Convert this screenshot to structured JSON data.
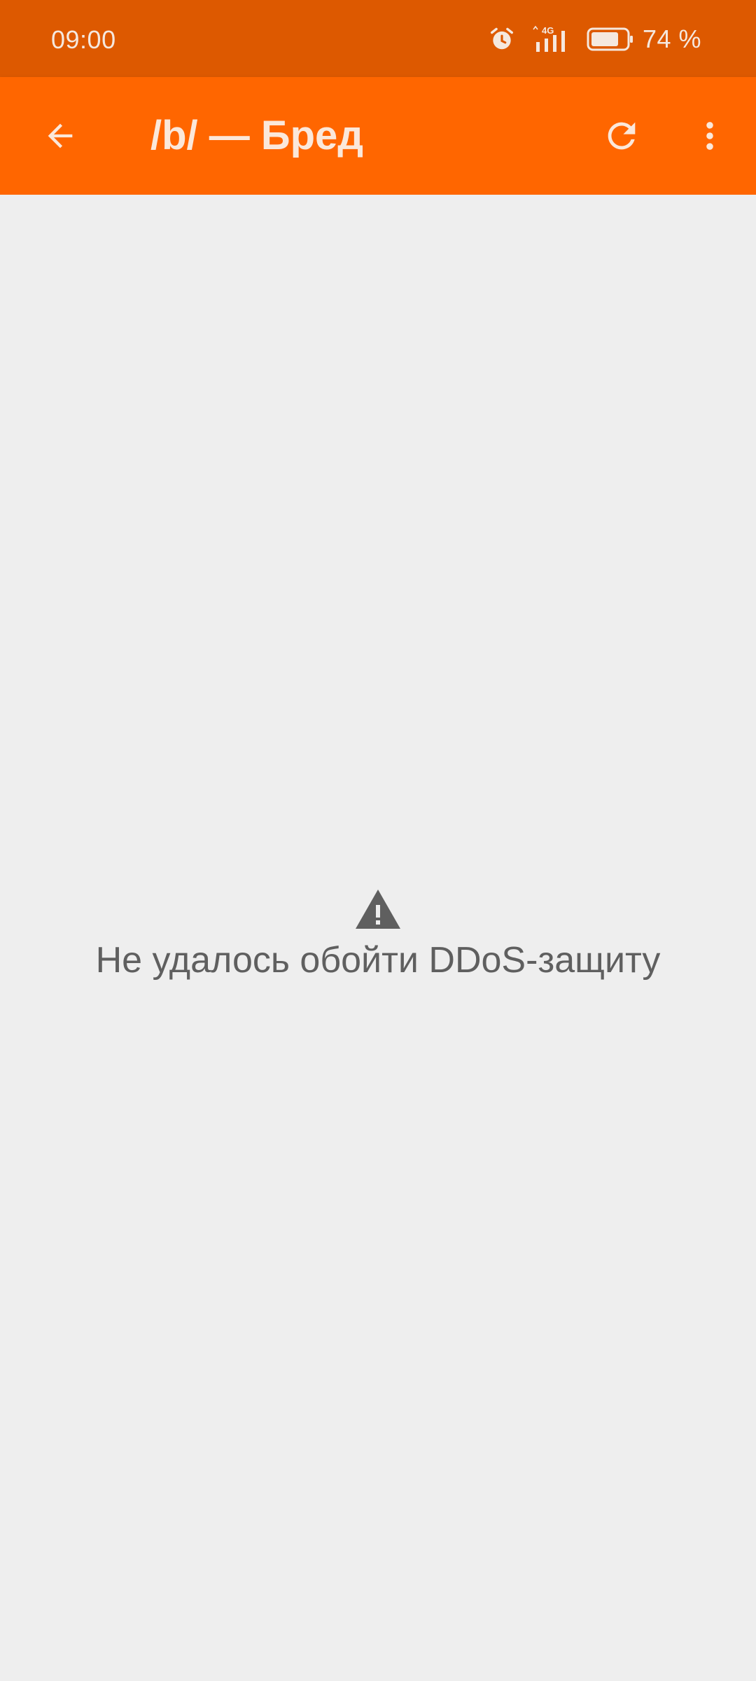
{
  "status_bar": {
    "time": "09:00",
    "network": "4G",
    "battery": "74 %",
    "icons": [
      "alarm-icon",
      "signal-icon",
      "battery-icon"
    ]
  },
  "app_bar": {
    "title": "/b/ — Бред",
    "icons": [
      "back-arrow-icon",
      "refresh-icon",
      "more-vert-icon"
    ],
    "color": "#ff6600"
  },
  "content": {
    "error_message": "Не удалось обойти DDoS-защиту",
    "error_icon": "warning-icon"
  },
  "colors": {
    "status_bar": "#dd5900",
    "app_bar": "#ff6600",
    "background": "#eeeeee",
    "error_text": "#5f5f5f"
  }
}
